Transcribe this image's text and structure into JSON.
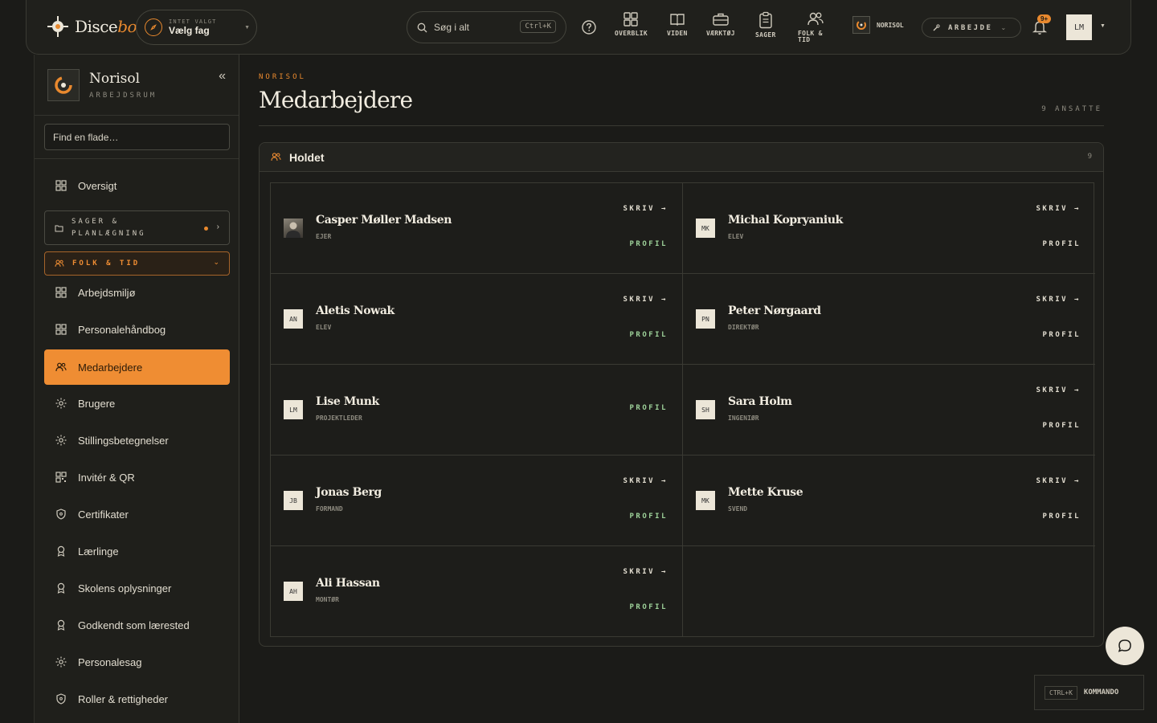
{
  "topbar": {
    "logo_text": "Disce",
    "logo_accent": "bo",
    "subject_small": "INTET VALGT",
    "subject_value": "Vælg fag",
    "search_placeholder": "Søg i alt",
    "search_shortcut": "Ctrl+K",
    "nav": [
      {
        "label": "OVERBLIK",
        "icon": "grid-icon"
      },
      {
        "label": "VIDEN",
        "icon": "book-icon"
      },
      {
        "label": "VÆRKTØJ",
        "icon": "briefcase-icon"
      },
      {
        "label": "SAGER",
        "icon": "clipboard-icon"
      },
      {
        "label_line1": "FOLK &",
        "label_line2": "TID",
        "icon": "people-icon"
      }
    ],
    "org_label": "NORISOL",
    "mode_label": "ARBEJDE",
    "notification_badge": "9+",
    "user_initials": "LM"
  },
  "sidebar": {
    "org_name": "Norisol",
    "org_subtitle": "ARBEJDSRUM",
    "search_placeholder": "Find en flade…",
    "items": [
      {
        "label": "Oversigt"
      },
      {
        "group": "SAGER & PLANLÆGNING"
      },
      {
        "group": "FOLK & TID"
      },
      {
        "label": "Arbejdsmiljø"
      },
      {
        "label": "Personalehåndbog"
      },
      {
        "label": "Medarbejdere"
      },
      {
        "label": "Brugere"
      },
      {
        "label": "Stillingsbetegnelser"
      },
      {
        "label": "Invitér & QR"
      },
      {
        "label": "Certifikater"
      },
      {
        "label": "Lærlinge"
      },
      {
        "label": "Skolens oplysninger"
      },
      {
        "label": "Godkendt som lærested"
      },
      {
        "label": "Personalesag"
      },
      {
        "label": "Roller & rettigheder"
      }
    ],
    "group1_line1": "SAGER &",
    "group1_line2": "PLANLÆGNING",
    "group2": "FOLK & TID"
  },
  "main": {
    "eyebrow": "NORISOL",
    "title": "Medarbejdere",
    "count": "9 ANSATTE",
    "panel_title": "Holdet",
    "panel_count": "9",
    "write_label": "SKRIV",
    "profile_label": "PROFIL",
    "employees": [
      {
        "name": "Casper Møller Madsen",
        "role": "EJER",
        "initials": ""
      },
      {
        "name": "Michal Kopryaniuk",
        "role": "ELEV",
        "initials": "MK"
      },
      {
        "name": "Aletis Nowak",
        "role": "ELEV",
        "initials": "AN"
      },
      {
        "name": "Peter Nørgaard",
        "role": "DIREKTØR",
        "initials": "PN"
      },
      {
        "name": "Lise Munk",
        "role": "PROJEKTLEDER",
        "initials": "LM"
      },
      {
        "name": "Sara Holm",
        "role": "INGENIØR",
        "initials": "SH"
      },
      {
        "name": "Jonas Berg",
        "role": "FORMAND",
        "initials": "JB"
      },
      {
        "name": "Mette Kruse",
        "role": "SVEND",
        "initials": "MK"
      },
      {
        "name": "Ali Hassan",
        "role": "MONTØR",
        "initials": "AH"
      }
    ]
  },
  "command": {
    "shortcut": "CTRL+K",
    "label": "KOMMANDO"
  },
  "colors": {
    "accent": "#ef8d33",
    "background": "#1b1b18",
    "profile_link": "#9ed29a"
  }
}
